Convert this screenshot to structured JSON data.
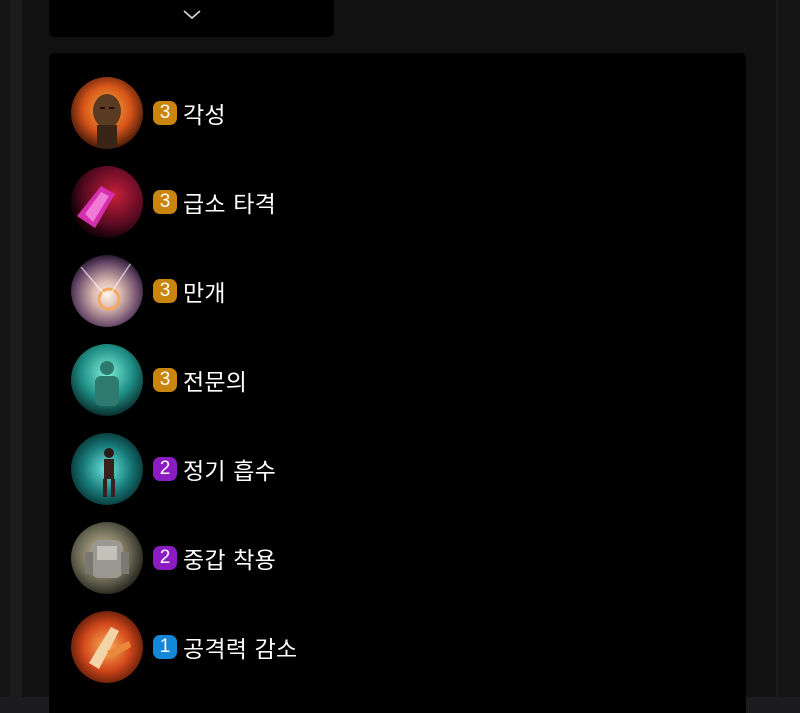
{
  "colors": {
    "tier3": "#c98510",
    "tier2": "#8a1cc1",
    "tier1": "#1487d9"
  },
  "traits": [
    {
      "icon": "awakening-icon",
      "count": "3",
      "name": "각성",
      "tier": "tier3"
    },
    {
      "icon": "surge-strike-icon",
      "count": "3",
      "name": "급소 타격",
      "tier": "tier3"
    },
    {
      "icon": "bloom-icon",
      "count": "3",
      "name": "만개",
      "tier": "tier3"
    },
    {
      "icon": "expert-icon",
      "count": "3",
      "name": "전문의",
      "tier": "tier3"
    },
    {
      "icon": "essence-drain-icon",
      "count": "2",
      "name": "정기 흡수",
      "tier": "tier2"
    },
    {
      "icon": "heavy-armor-icon",
      "count": "2",
      "name": "중갑 착용",
      "tier": "tier2"
    },
    {
      "icon": "attack-down-icon",
      "count": "1",
      "name": "공격력 감소",
      "tier": "tier1"
    }
  ]
}
